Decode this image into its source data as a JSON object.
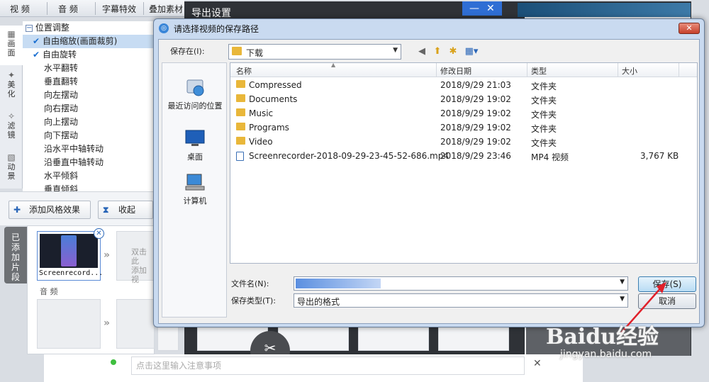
{
  "app": {
    "top_menu": [
      "视  频",
      "音  频",
      "字幕特效",
      "叠加素材"
    ],
    "left_tabs": [
      {
        "label": "画\n面",
        "icon": "film-icon"
      },
      {
        "label": "美\n化",
        "icon": "wand-icon"
      },
      {
        "label": "滤\n镜",
        "icon": "sparkle-icon"
      },
      {
        "label": "动\n景",
        "icon": "grid-icon"
      }
    ],
    "tree": {
      "header": "位置调整",
      "items": [
        {
          "label": "自由缩放(画面裁剪)",
          "checked": true,
          "selected": true
        },
        {
          "label": "自由旋转",
          "checked": true,
          "selected": false
        },
        {
          "label": "水平翻转",
          "checked": false,
          "selected": false
        },
        {
          "label": "垂直翻转",
          "checked": false,
          "selected": false
        },
        {
          "label": "向左摆动",
          "checked": false,
          "selected": false
        },
        {
          "label": "向右摆动",
          "checked": false,
          "selected": false
        },
        {
          "label": "向上摆动",
          "checked": false,
          "selected": false
        },
        {
          "label": "向下摆动",
          "checked": false,
          "selected": false
        },
        {
          "label": "沿水平中轴转动",
          "checked": false,
          "selected": false
        },
        {
          "label": "沿垂直中轴转动",
          "checked": false,
          "selected": false
        },
        {
          "label": "水平倾斜",
          "checked": false,
          "selected": false
        },
        {
          "label": "垂直倾斜",
          "checked": false,
          "selected": false
        }
      ]
    },
    "add_style_button": "添加风格效果",
    "collapse_button": "收起",
    "added_clips_tab": "已\n添\n加\n片\n段",
    "clip_name": "Screenrecord...",
    "drop_hint": "双击此\n添加视",
    "audio_label": "音  频",
    "note_placeholder": "点击这里输入注意事项"
  },
  "export_dialog": {
    "title": "导出设置"
  },
  "file_dialog": {
    "title": "请选择视频的保存路径",
    "save_in_label": "保存在(I):",
    "save_in_value": "下载",
    "places": [
      {
        "label": "最近访问的位置",
        "icon": "recent-places-icon"
      },
      {
        "label": "桌面",
        "icon": "desktop-icon"
      },
      {
        "label": "计算机",
        "icon": "computer-icon"
      }
    ],
    "columns": [
      "名称",
      "修改日期",
      "类型",
      "大小"
    ],
    "files": [
      {
        "name": "Compressed",
        "date": "2018/9/29 21:03",
        "type": "文件夹",
        "size": "",
        "kind": "folder"
      },
      {
        "name": "Documents",
        "date": "2018/9/29 19:02",
        "type": "文件夹",
        "size": "",
        "kind": "folder"
      },
      {
        "name": "Music",
        "date": "2018/9/29 19:02",
        "type": "文件夹",
        "size": "",
        "kind": "folder"
      },
      {
        "name": "Programs",
        "date": "2018/9/29 19:02",
        "type": "文件夹",
        "size": "",
        "kind": "folder"
      },
      {
        "name": "Video",
        "date": "2018/9/29 19:02",
        "type": "文件夹",
        "size": "",
        "kind": "folder"
      },
      {
        "name": "Screenrecorder-2018-09-29-23-45-52-686.mp4",
        "date": "2018/9/29 23:46",
        "type": "MP4 视频",
        "size": "3,767 KB",
        "kind": "mp4"
      }
    ],
    "filename_label": "文件名(N):",
    "filetype_label": "保存类型(T):",
    "filetype_value": "导出的格式",
    "save_button": "保存(S)",
    "cancel_button": "取消"
  },
  "watermark": {
    "brand": "Baidu经验",
    "url": "jingyan.baidu.com"
  },
  "colors": {
    "selection": "#c7dcf3",
    "accent": "#2f6ed4",
    "annotation_arrow": "#e0202a"
  }
}
